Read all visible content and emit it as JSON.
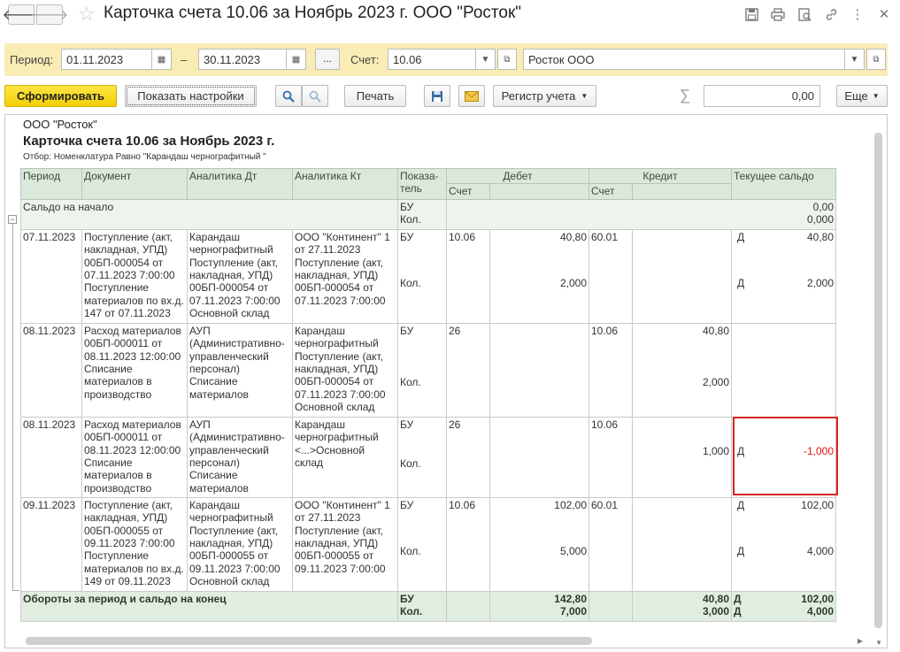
{
  "window": {
    "title": "Карточка счета 10.06 за Ноябрь 2023 г. ООО \"Росток\""
  },
  "filters": {
    "period_label": "Период:",
    "date_from": "01.11.2023",
    "dash": "–",
    "date_to": "30.11.2023",
    "dots": "...",
    "account_label": "Счет:",
    "account": "10.06",
    "organization": "Росток ООО"
  },
  "toolbar": {
    "generate": "Сформировать",
    "show_settings": "Показать настройки",
    "print": "Печать",
    "register": "Регистр учета",
    "sum_symbol": "∑",
    "sum_value": "0,00",
    "more": "Еще"
  },
  "report": {
    "org": "ООО \"Росток\"",
    "title": "Карточка счета 10.06 за Ноябрь 2023 г.",
    "filter_note": "Отбор: Номенклатура Равно \"Карандаш черногрaфитный \"",
    "headers": {
      "period": "Период",
      "document": "Документ",
      "analytics_dt": "Аналитика Дт",
      "analytics_kt": "Аналитика Кт",
      "indicator": "Показа-тель",
      "debit": "Дебет",
      "credit": "Кредит",
      "balance": "Текущее сальдо",
      "account": "Счет"
    },
    "opening": {
      "label": "Сальдо на начало",
      "ind1": "БУ",
      "ind2": "Кол.",
      "val1": "0,00",
      "val2": "0,000"
    },
    "rows": [
      {
        "period": "07.11.2023",
        "document": "Поступление (акт, накладная, УПД) 00БП-000054 от 07.11.2023 7:00:00 Поступление материалов по вх.д. 147 от 07.11.2023",
        "dt": "Карандаш черногрaфитный Поступление (акт, накладная, УПД) 00БП-000054 от 07.11.2023 7:00:00 Основной склад",
        "kt": "ООО \"Континент\" 1 от 27.11.2023 Поступление (акт, накладная, УПД) 00БП-000054 от 07.11.2023 7:00:00",
        "ind1": "БУ",
        "ind2": "Кол.",
        "dacc": "10.06",
        "dsum": "40,80",
        "dqty": "2,000",
        "kacc": "60.01",
        "ksum": "",
        "kqty": "",
        "bd1": "Д",
        "bv1": "40,80",
        "bd2": "Д",
        "bv2": "2,000"
      },
      {
        "period": "08.11.2023",
        "document": "Расход материалов 00БП-000011 от 08.11.2023 12:00:00 Списание материалов в производство",
        "dt": "АУП (Административно-управленческий персонал) Списание материалов",
        "kt": "Карандаш черногрaфитный Поступление (акт, накладная, УПД) 00БП-000054 от 07.11.2023 7:00:00 Основной склад",
        "ind1": "БУ",
        "ind2": "Кол.",
        "dacc": "26",
        "dsum": "",
        "dqty": "",
        "kacc": "10.06",
        "ksum": "40,80",
        "kqty": "2,000",
        "bd1": "",
        "bv1": "",
        "bd2": "",
        "bv2": ""
      },
      {
        "period": "08.11.2023",
        "document": "Расход материалов 00БП-000011 от 08.11.2023 12:00:00 Списание материалов в производство",
        "dt": "АУП (Административно-управленческий персонал) Списание материалов",
        "kt": "Карандаш черногрaфитный <...>Основной склад",
        "ind1": "БУ",
        "ind2": "Кол.",
        "dacc": "26",
        "dsum": "",
        "dqty": "",
        "kacc": "10.06",
        "ksum": "",
        "kqty": "1,000",
        "bd1": "",
        "bv1": "",
        "bd2": "Д",
        "bv2": "-1,000"
      },
      {
        "period": "09.11.2023",
        "document": "Поступление (акт, накладная, УПД) 00БП-000055 от 09.11.2023 7:00:00 Поступление материалов по вх.д. 149 от 09.11.2023",
        "dt": "Карандаш черногрaфитный Поступление (акт, накладная, УПД) 00БП-000055 от 09.11.2023 7:00:00 Основной склад",
        "kt": "ООО \"Континент\" 1 от 27.11.2023 Поступление (акт, накладная, УПД) 00БП-000055 от 09.11.2023 7:00:00",
        "ind1": "БУ",
        "ind2": "Кол.",
        "dacc": "10.06",
        "dsum": "102,00",
        "dqty": "5,000",
        "kacc": "60.01",
        "ksum": "",
        "kqty": "",
        "bd1": "Д",
        "bv1": "102,00",
        "bd2": "Д",
        "bv2": "4,000"
      }
    ],
    "totals": {
      "label": "Обороты за период и сальдо на конец",
      "ind1": "БУ",
      "ind2": "Кол.",
      "dsum": "142,80",
      "dqty": "7,000",
      "ksum": "40,80",
      "kqty": "3,000",
      "bd1": "Д",
      "bv1": "102,00",
      "bd2": "Д",
      "bv2": "4,000"
    }
  }
}
